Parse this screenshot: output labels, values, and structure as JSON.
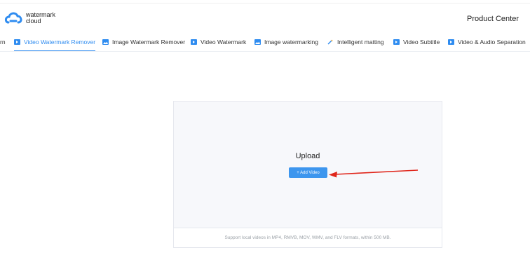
{
  "logo": {
    "line1": "watermark",
    "line2": "cloud"
  },
  "header": {
    "product_center": "Product Center"
  },
  "nav": {
    "items": [
      {
        "label": "rn",
        "icon": ""
      },
      {
        "label": "Video Watermark Remover",
        "icon": "video-icon",
        "active": true
      },
      {
        "label": "Image Watermark Remover",
        "icon": "image-icon"
      },
      {
        "label": "Video Watermark",
        "icon": "video-icon"
      },
      {
        "label": "Image watermarking",
        "icon": "image-icon"
      },
      {
        "label": "Intelligent matting",
        "icon": "magic-wand-icon"
      },
      {
        "label": "Video Subtitle",
        "icon": "video-icon"
      },
      {
        "label": "Video & Audio Separation",
        "icon": "video-icon"
      }
    ]
  },
  "upload": {
    "title": "Upload",
    "button": "+ Add Video",
    "footer": "Support local videos in MP4, RMVB, MOV, WMV, and FLV formats,  within 500 MB."
  },
  "colors": {
    "accent": "#2f8cf0",
    "button": "#3d96ee",
    "arrow": "#e0261b"
  }
}
